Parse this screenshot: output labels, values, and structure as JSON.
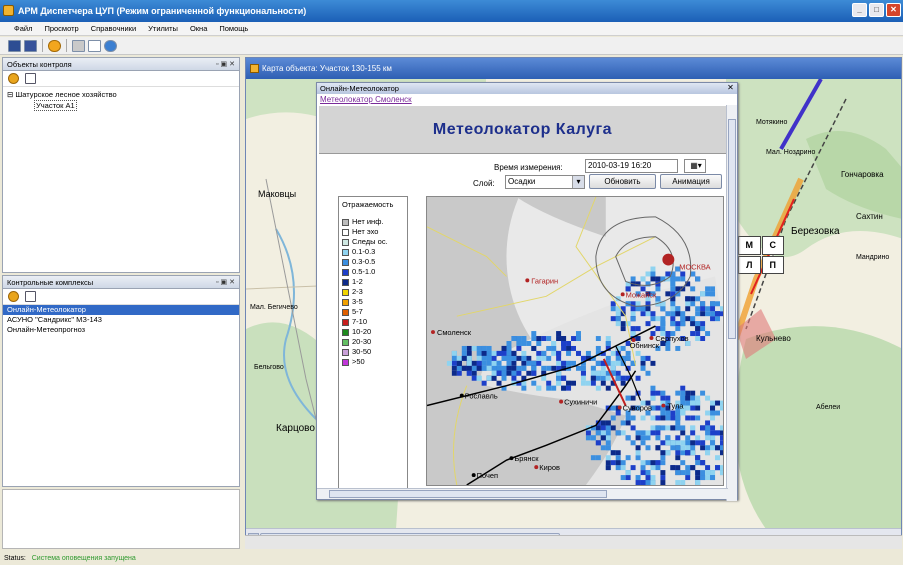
{
  "window": {
    "title": "АРМ Диспетчера ЦУП (Режим ограниченной функциональности)"
  },
  "menu": [
    "Файл",
    "Просмотр",
    "Справочники",
    "Утилиты",
    "Окна",
    "Помощь"
  ],
  "panels": {
    "objects": {
      "title": "Объекты контроля",
      "tree_root": "Шатурское лесное хозяйство",
      "tree_child": "Участок А1"
    },
    "complexes": {
      "title": "Контрольные комплексы",
      "items": [
        "Онлайн-Метеолокатор",
        "АСУНО \"Сандрикс\" МЗ-143",
        "Онлайн-Метеопрогноз"
      ]
    }
  },
  "map_window": {
    "title": "Карта объекта: Участок 130-155 км",
    "legend_letters": [
      "М",
      "С",
      "Л",
      "П"
    ],
    "labels": [
      "Маковцы",
      "Мал. Бегичево",
      "Бельгово",
      "Карцово",
      "Березовка",
      "Кульнево",
      "Мотякино",
      "Гончаровка",
      "Мандрино",
      "Абелеи",
      "Мал. Ноздрино",
      "Сахтин"
    ]
  },
  "meteo": {
    "window_title": "Онлайн-Метеолокатор",
    "link": "Метеолокатор Смоленск",
    "heading": "Метеолокатор Калуга",
    "time_label": "Время измерения:",
    "time_value": "2010-03-19 16:20",
    "layer_label": "Слой:",
    "layer_value": "Осадки",
    "refresh_btn": "Обновить",
    "animation_btn": "Анимация",
    "legend_title": "Отражаемость",
    "legend": [
      {
        "label": "Нет инф.",
        "color": "#bdbdbd"
      },
      {
        "label": "Нет эхо",
        "color": "#ffffff"
      },
      {
        "label": "Следы ос.",
        "color": "#cfe8e2"
      },
      {
        "label": "0.1-0.3",
        "color": "#8fd3f0"
      },
      {
        "label": "0.3-0.5",
        "color": "#3b8fe0"
      },
      {
        "label": "0.5-1.0",
        "color": "#1d3fc9"
      },
      {
        "label": "1-2",
        "color": "#0c2a8a"
      },
      {
        "label": "2-3",
        "color": "#f0d400"
      },
      {
        "label": "3-5",
        "color": "#f0a000"
      },
      {
        "label": "5-7",
        "color": "#e06000"
      },
      {
        "label": "7-10",
        "color": "#c81e1e"
      },
      {
        "label": "10-20",
        "color": "#1e8a1e"
      },
      {
        "label": "20-30",
        "color": "#63c063"
      },
      {
        "label": "30-50",
        "color": "#c9a0d8"
      },
      {
        "label": ">50",
        "color": "#c036d8"
      }
    ],
    "cities": [
      "Гагарин",
      "МОСКВА",
      "Можайск",
      "Смоленск",
      "Серпухов",
      "Обнинск",
      "Рославль",
      "Сухиничи",
      "Суворов",
      "Тула",
      "Брянск",
      "Киров",
      "Почеп"
    ]
  },
  "status": {
    "label": "Status",
    "value": "Система оповещения запущена"
  }
}
